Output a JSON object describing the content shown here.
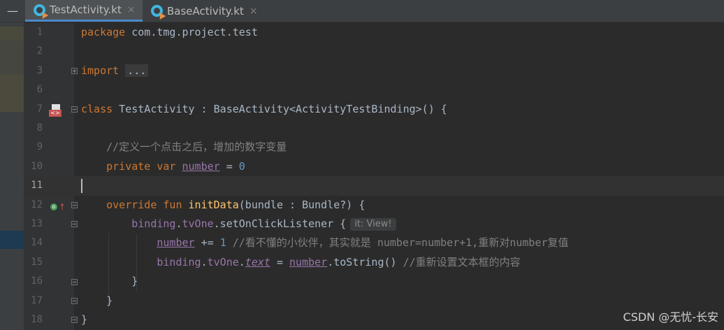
{
  "tabs": [
    {
      "label": "TestActivity.kt",
      "active": true
    },
    {
      "label": "BaseActivity.kt",
      "active": false
    }
  ],
  "close_glyph": "×",
  "collapse_glyph": "—",
  "lines": [
    {
      "n": "1"
    },
    {
      "n": "2"
    },
    {
      "n": "3"
    },
    {
      "n": "6"
    },
    {
      "n": "7"
    },
    {
      "n": "8"
    },
    {
      "n": "9"
    },
    {
      "n": "10"
    },
    {
      "n": "11"
    },
    {
      "n": "12"
    },
    {
      "n": "13"
    },
    {
      "n": "14"
    },
    {
      "n": "15"
    },
    {
      "n": "16"
    },
    {
      "n": "17"
    },
    {
      "n": "18"
    }
  ],
  "code": {
    "l1_kw": "package",
    "l1_rest": " com.tmg.project.test",
    "l3_kw": "import",
    "l3_fold": "...",
    "l7_kw": "class",
    "l7_rest": " TestActivity : BaseActivity<ActivityTestBinding>() {",
    "l9_cmt": "//定义一个点击之后，增加的数字变量",
    "l10_kw1": "private",
    "l10_kw2": "var",
    "l10_prop": "number",
    "l10_eq": " = ",
    "l10_num": "0",
    "l12_kw1": "override",
    "l12_kw2": "fun",
    "l12_fn": "initData",
    "l12_rest": "(bundle : Bundle?) {",
    "l13_a": "binding",
    "l13_b": ".",
    "l13_c": "tvOne",
    "l13_d": ".setOnClickListener {",
    "l13_hint": "it: View!",
    "l14_prop": "number",
    "l14_op": " += ",
    "l14_num": "1",
    "l14_cmt": " //看不懂的小伙伴，其实就是 number=number+1,重新对number复值",
    "l15_a": "binding",
    "l15_b": ".",
    "l15_c": "tvOne",
    "l15_d": ".",
    "l15_e": "text",
    "l15_f": " = ",
    "l15_g": "number",
    "l15_h": ".toString() ",
    "l15_cmt": "//重新设置文本框的内容",
    "l16": "}",
    "l17": "}",
    "l18": "}"
  },
  "watermark": "CSDN @无忧-长安",
  "colors": {
    "keyword": "#cc7832",
    "property": "#9876aa",
    "function": "#ffc66d",
    "number": "#6897bb",
    "comment": "#808080",
    "text": "#a9b7c6",
    "background": "#2b2b2b"
  }
}
